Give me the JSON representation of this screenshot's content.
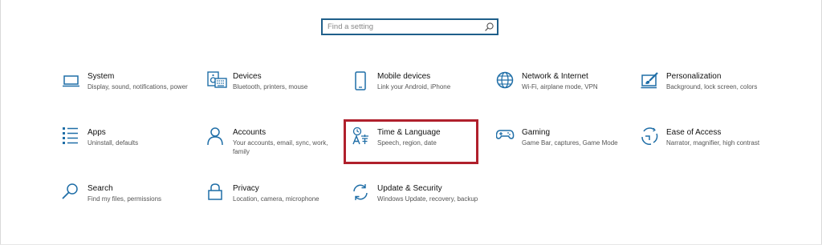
{
  "search": {
    "placeholder": "Find a setting"
  },
  "tiles": [
    {
      "title": "System",
      "desc": "Display, sound, notifications, power",
      "icon": "monitor-icon"
    },
    {
      "title": "Devices",
      "desc": "Bluetooth, printers, mouse",
      "icon": "keyboard-speaker-icon"
    },
    {
      "title": "Mobile devices",
      "desc": "Link your Android, iPhone",
      "icon": "phone-icon"
    },
    {
      "title": "Network & Internet",
      "desc": "Wi-Fi, airplane mode, VPN",
      "icon": "globe-icon"
    },
    {
      "title": "Personalization",
      "desc": "Background, lock screen, colors",
      "icon": "paint-brush-icon"
    },
    {
      "title": "Apps",
      "desc": "Uninstall, defaults",
      "icon": "apps-list-icon"
    },
    {
      "title": "Accounts",
      "desc": "Your accounts, email, sync, work, family",
      "icon": "person-icon"
    },
    {
      "title": "Time & Language",
      "desc": "Speech, region, date",
      "icon": "time-language-icon"
    },
    {
      "title": "Gaming",
      "desc": "Game Bar, captures, Game Mode",
      "icon": "gamepad-icon"
    },
    {
      "title": "Ease of Access",
      "desc": "Narrator, magnifier, high contrast",
      "icon": "ease-of-access-icon"
    },
    {
      "title": "Search",
      "desc": "Find my files, permissions",
      "icon": "search-magnifier-icon"
    },
    {
      "title": "Privacy",
      "desc": "Location, camera, microphone",
      "icon": "lock-icon"
    },
    {
      "title": "Update & Security",
      "desc": "Windows Update, recovery, backup",
      "icon": "sync-arrows-icon"
    }
  ],
  "colors": {
    "accent": "#1f6ea7",
    "highlight": "#b0202c"
  }
}
